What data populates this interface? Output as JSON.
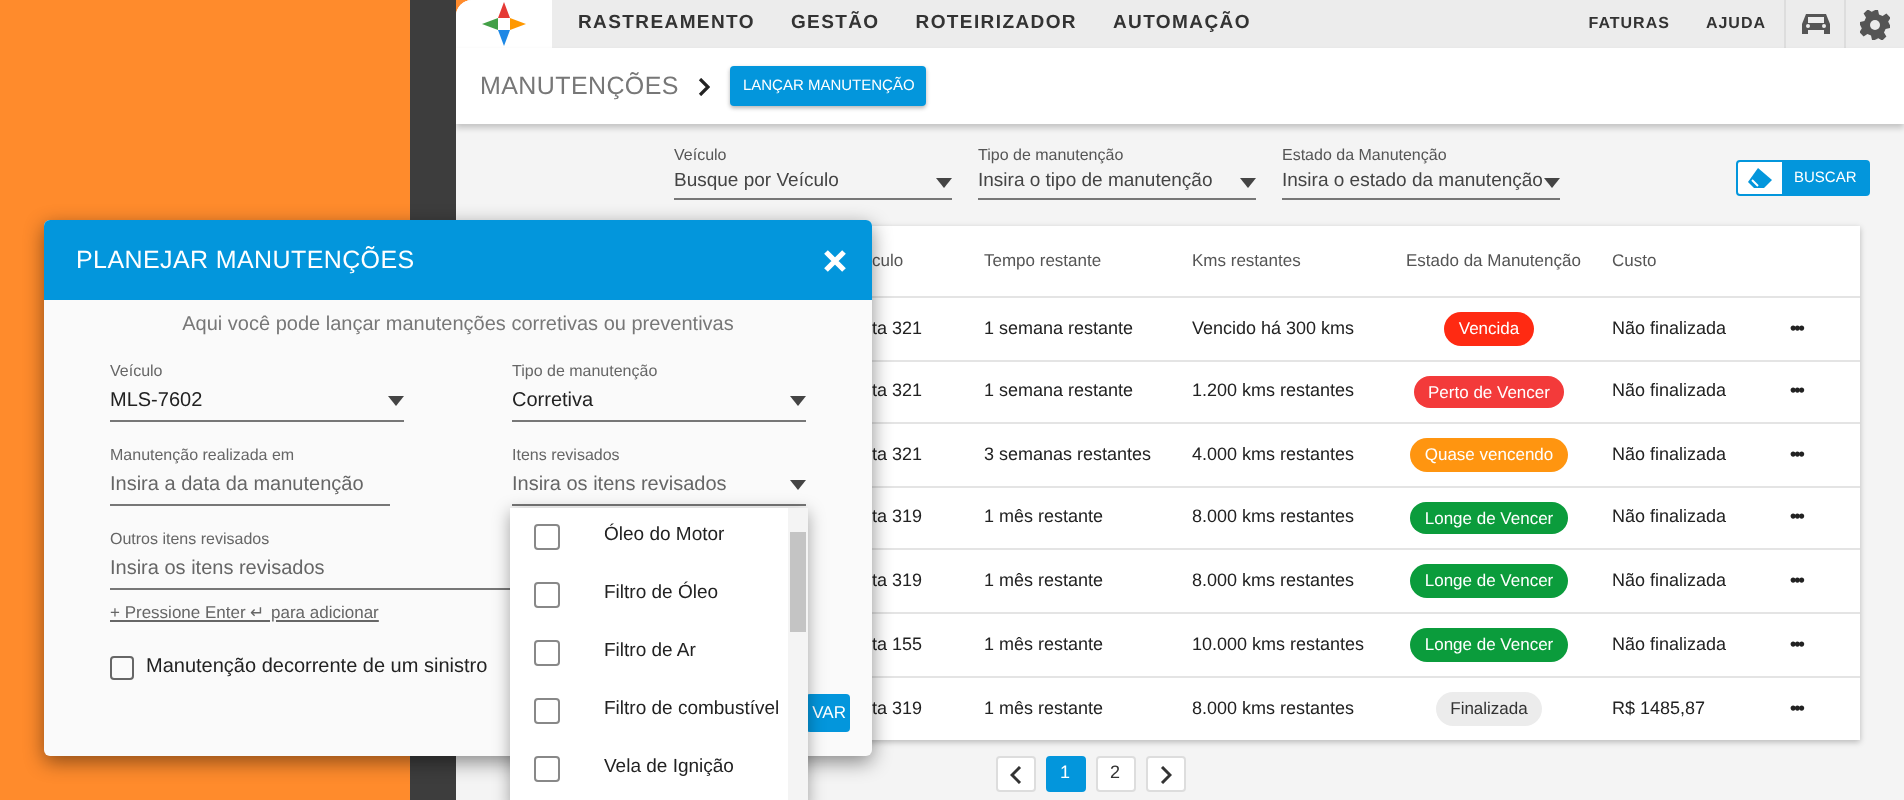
{
  "nav": {
    "items": [
      "RASTREAMENTO",
      "GESTÃO",
      "ROTEIRIZADOR",
      "AUTOMAÇÃO"
    ],
    "right_items": [
      "FATURAS",
      "AJUDA"
    ]
  },
  "header": {
    "title": "MANUTENÇÕES",
    "action": "LANÇAR MANUTENÇÃO"
  },
  "filters": [
    {
      "label": "Veículo",
      "placeholder": "Busque por Veículo"
    },
    {
      "label": "Tipo de manutenção",
      "placeholder": "Insira o tipo de manutenção"
    },
    {
      "label": "Estado da Manutenção",
      "placeholder": "Insira o estado da manutenção"
    }
  ],
  "search_button": "BUSCAR",
  "table": {
    "columns": [
      "culo",
      "Tempo restante",
      "Kms restantes",
      "Estado da Manutenção",
      "Custo"
    ],
    "rows": [
      {
        "vehicle": "ta 321",
        "time": "1 semana restante",
        "kms": "Vencido há 300 kms",
        "status": "Vencida",
        "color": "#ff2a12",
        "cost": "Não finalizada",
        "actions": "•••"
      },
      {
        "vehicle": "ta 321",
        "time": "1 semana restante",
        "kms": "1.200 kms restantes",
        "status": "Perto de Vencer",
        "color": "#f33a3a",
        "cost": "Não finalizada",
        "actions": "•••"
      },
      {
        "vehicle": "ta 321",
        "time": "3 semanas restantes",
        "kms": "4.000 kms restantes",
        "status": "Quase vencendo",
        "color": "#ff9510",
        "cost": "Não finalizada",
        "actions": "•••"
      },
      {
        "vehicle": "ta 319",
        "time": "1 mês restante",
        "kms": "8.000 kms restantes",
        "status": "Longe de Vencer",
        "color": "#0b9c3c",
        "cost": "Não finalizada",
        "actions": "•••"
      },
      {
        "vehicle": "ta 319",
        "time": "1 mês restante",
        "kms": "8.000 kms restantes",
        "status": "Longe de Vencer",
        "color": "#0b9c3c",
        "cost": "Não finalizada",
        "actions": "•••"
      },
      {
        "vehicle": "ta 155",
        "time": "1 mês restante",
        "kms": "10.000 kms restantes",
        "status": "Longe de Vencer",
        "color": "#0b9c3c",
        "cost": "Não finalizada",
        "actions": "•••"
      },
      {
        "vehicle": "ta 319",
        "time": "1 mês restante",
        "kms": "8.000 kms restantes",
        "status": "Finalizada",
        "color": "#ececec",
        "cost": "R$ 1485,87",
        "actions": "•••"
      }
    ]
  },
  "pagination": {
    "pages": [
      {
        "label": "1",
        "selected": true
      },
      {
        "label": "2",
        "selected": false
      }
    ]
  },
  "modal": {
    "title": "PLANEJAR MANUTENÇÕES",
    "subtitle": "Aqui você pode lançar manutenções corretivas ou preventivas",
    "fields": [
      {
        "kind": "select",
        "label": "Veículo",
        "value": "MLS-7602"
      },
      {
        "kind": "select",
        "label": "Tipo de manutenção",
        "value": "Corretiva"
      },
      {
        "kind": "input",
        "label": "Manutenção realizada em",
        "placeholder": "Insira a data da manutenção"
      },
      {
        "kind": "select",
        "label": "Itens revisados",
        "placeholder": "Insira os itens revisados"
      },
      {
        "kind": "wide",
        "label": "Outros itens revisados",
        "placeholder": "Insira os itens revisados"
      }
    ],
    "hint": "+ Pressione Enter ↵ para adicionar",
    "checkbox": {
      "label": "Manutenção decorrente de um sinistro",
      "checked": false
    },
    "save_button": "VAR"
  },
  "dropdown": {
    "options": [
      {
        "label": "Óleo do Motor",
        "checked": false
      },
      {
        "label": "Filtro de Óleo",
        "checked": false
      },
      {
        "label": "Filtro de Ar",
        "checked": false
      },
      {
        "label": "Filtro de combustível",
        "checked": false
      },
      {
        "label": "Vela de Ignição",
        "checked": false
      }
    ]
  }
}
